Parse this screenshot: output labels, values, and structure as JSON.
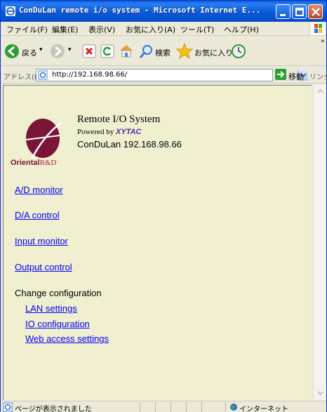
{
  "window": {
    "title": "ConDuLan remote i/o system - Microsoft Internet E..."
  },
  "menu": {
    "items": [
      "ファイル(F)",
      "編集(E)",
      "表示(V)",
      "お気に入り(A)",
      "ツール(T)",
      "ヘルプ(H)"
    ]
  },
  "toolbar": {
    "back_label": "戻る",
    "search_label": "検索",
    "favorites_label": "お気に入り"
  },
  "address": {
    "label": "アドレス(D)",
    "url": "http://192.168.98.66/",
    "go_label": "移動",
    "links_label": "リンク"
  },
  "page": {
    "title": "Remote I/O System",
    "powered_prefix": "Powered by ",
    "powered_brand": "XYTAC",
    "device": "ConDuLan 192.168.98.66",
    "logo_text": "Oriental",
    "logo_text_rnd": "R&D",
    "links": [
      "A/D monitor",
      "D/A control",
      "Input monitor",
      "Output control"
    ],
    "config_heading": "Change configuration",
    "config_links": [
      "LAN settings",
      "IO configuration",
      "Web access settings"
    ]
  },
  "status": {
    "text": "ページが表示されました",
    "zone": "インターネット"
  }
}
